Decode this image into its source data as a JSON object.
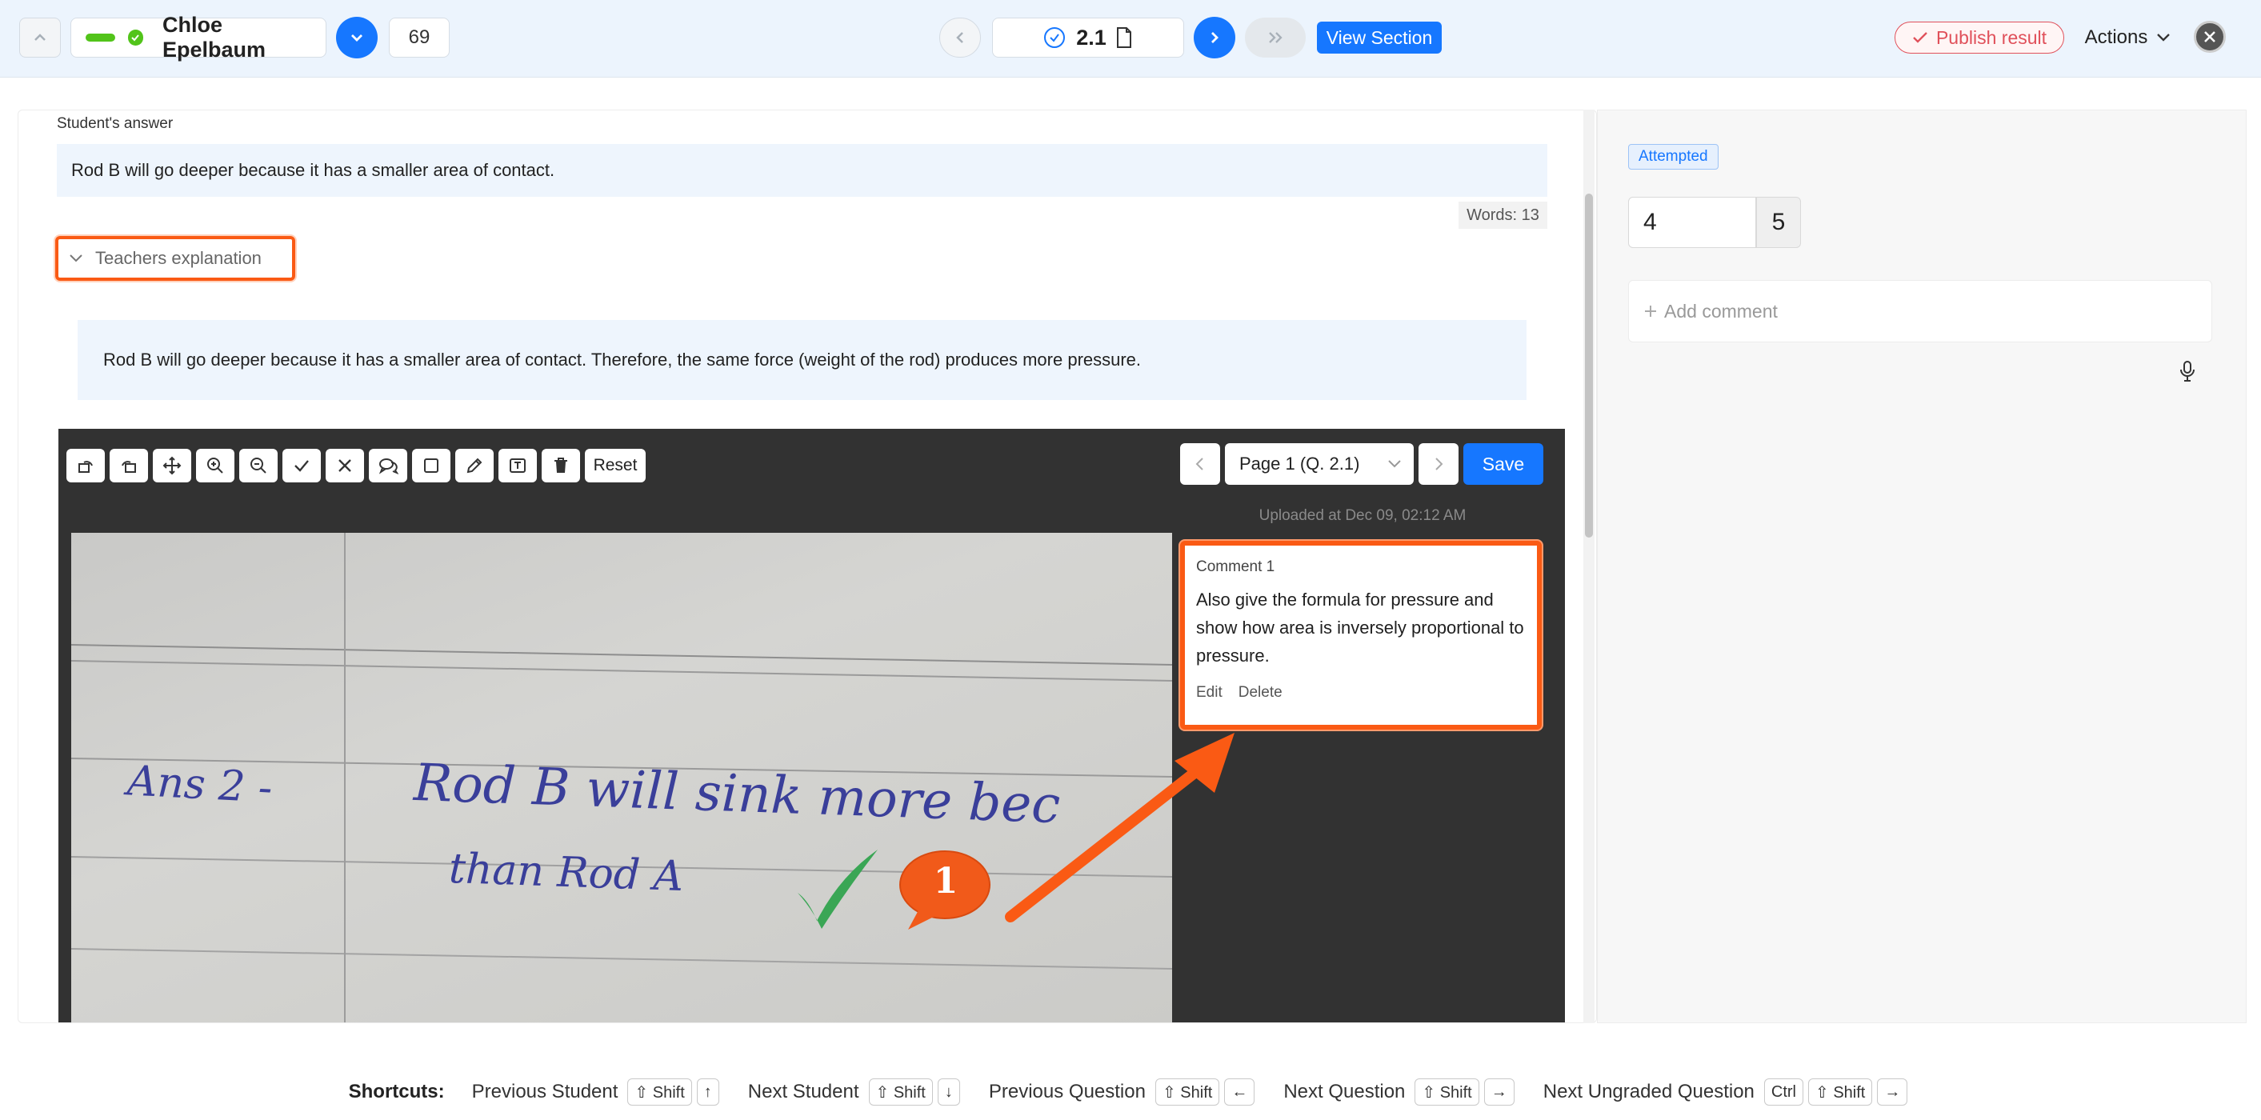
{
  "header": {
    "student_name": "Chloe Epelbaum",
    "student_number": "69",
    "question_number": "2.1",
    "view_section_label": "View Section",
    "publish_label": "Publish result",
    "actions_label": "Actions"
  },
  "main": {
    "answer_heading": "Student's answer",
    "answer_text": "Rod B will go deeper because it has a smaller area of contact.",
    "word_count": "Words: 13",
    "teacher_toggle_label": "Teachers explanation",
    "teacher_text": "Rod B will go deeper because it has a smaller area of contact. Therefore, the same force (weight of the rod) produces more pressure."
  },
  "viewer": {
    "reset_label": "Reset",
    "page_select": "Page 1 (Q. 2.1)",
    "save_label": "Save",
    "uploaded": "Uploaded at Dec 09, 02:12 AM",
    "handwriting_line1_prefix": "Ans 2 -",
    "handwriting_line1": "Rod B will sink more bec",
    "handwriting_line2": "than Rod A",
    "marker_number": "1",
    "comment_title": "Comment 1",
    "comment_text": "Also give the formula for pressure and show how area is inversely proportional to pressure.",
    "comment_edit": "Edit",
    "comment_delete": "Delete"
  },
  "grading": {
    "status_badge": "Attempted",
    "score_value": "4",
    "max_score": "5",
    "add_comment": "Add comment"
  },
  "shortcuts": {
    "title": "Shortcuts:",
    "items": [
      {
        "label": "Previous Student",
        "keys": [
          "⇧ Shift",
          "↑"
        ]
      },
      {
        "label": "Next Student",
        "keys": [
          "⇧ Shift",
          "↓"
        ]
      },
      {
        "label": "Previous Question",
        "keys": [
          "⇧ Shift",
          "←"
        ]
      },
      {
        "label": "Next Question",
        "keys": [
          "⇧ Shift",
          "→"
        ]
      },
      {
        "label": "Next Ungraded Question",
        "keys": [
          "Ctrl",
          "⇧ Shift",
          "→"
        ]
      }
    ]
  },
  "colors": {
    "accent": "#1677ff",
    "highlight_orange": "#fa5a14",
    "check_green": "#3aa655",
    "publish_red": "#e0505a"
  }
}
